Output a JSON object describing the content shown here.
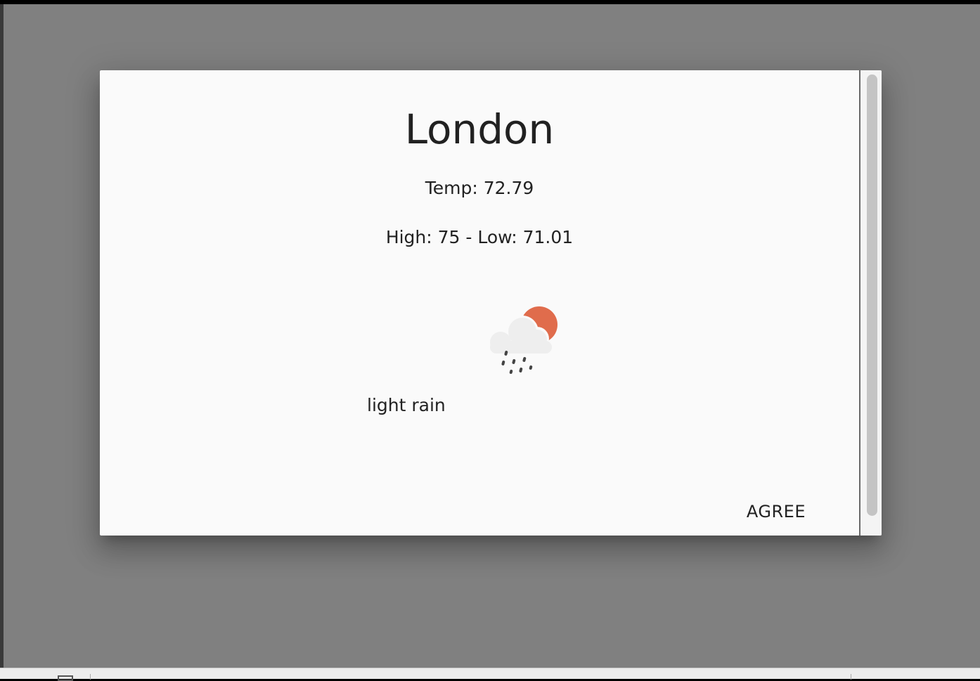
{
  "dialog": {
    "city": "London",
    "temperature": "Temp: 72.79",
    "high_low": "High: 75 - Low: 71.01",
    "weather_description": "light rain",
    "weather_icon": "cloud-sun-rain-icon",
    "action_label": "AGREE"
  },
  "colors": {
    "backdrop": "#808080",
    "dialog_background": "#fafafa",
    "sun": "#e06c4c",
    "cloud": "#eeeeee",
    "rain": "#444444",
    "text": "#212121"
  }
}
